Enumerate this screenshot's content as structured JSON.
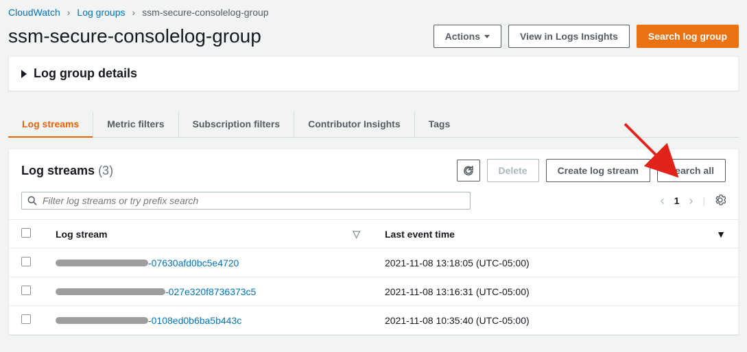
{
  "breadcrumb": {
    "items": [
      "CloudWatch",
      "Log groups"
    ],
    "current": "ssm-secure-consolelog-group"
  },
  "header": {
    "title": "ssm-secure-consolelog-group",
    "actions_label": "Actions",
    "insights_label": "View in Logs Insights",
    "search_group_label": "Search log group"
  },
  "details": {
    "title": "Log group details"
  },
  "tabs": [
    "Log streams",
    "Metric filters",
    "Subscription filters",
    "Contributor Insights",
    "Tags"
  ],
  "streams_panel": {
    "title": "Log streams",
    "count": "(3)",
    "delete_label": "Delete",
    "create_label": "Create log stream",
    "search_all_label": "Search all",
    "search_placeholder": "Filter log streams or try prefix search",
    "page": "1",
    "columns": {
      "name": "Log stream",
      "time": "Last event time"
    },
    "rows": [
      {
        "suffix": "-07630afd0bc5e4720",
        "redact_w": 135,
        "time": "2021-11-08 13:18:05 (UTC-05:00)"
      },
      {
        "suffix": "-027e320f8736373c5",
        "redact_w": 160,
        "time": "2021-11-08 13:16:31 (UTC-05:00)"
      },
      {
        "suffix": "-0108ed0b6ba5b443c",
        "redact_w": 135,
        "time": "2021-11-08 10:35:40 (UTC-05:00)"
      }
    ]
  }
}
